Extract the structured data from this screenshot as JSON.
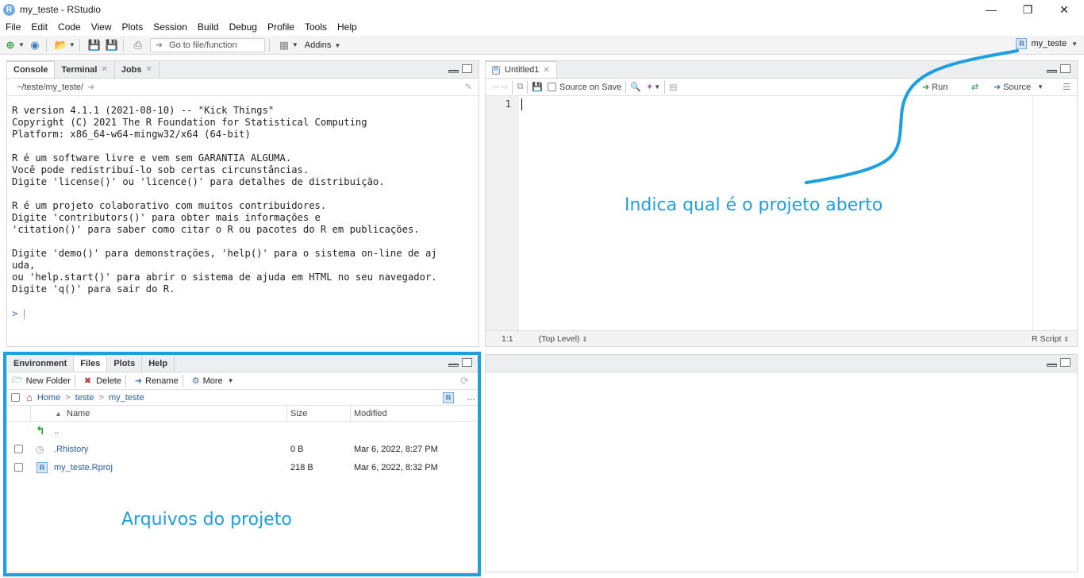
{
  "window": {
    "title": "my_teste - RStudio",
    "logo_letter": "R"
  },
  "menubar": [
    "File",
    "Edit",
    "Code",
    "View",
    "Plots",
    "Session",
    "Build",
    "Debug",
    "Profile",
    "Tools",
    "Help"
  ],
  "toolbar": {
    "goto_placeholder": "Go to file/function",
    "addins_label": "Addins",
    "project_name": "my_teste"
  },
  "console": {
    "tabs": [
      {
        "label": "Console",
        "active": true
      },
      {
        "label": "Terminal"
      },
      {
        "label": "Jobs"
      }
    ],
    "path": "~/teste/my_teste/",
    "lines": [
      "R version 4.1.1 (2021-08-10) -- \"Kick Things\"",
      "Copyright (C) 2021 The R Foundation for Statistical Computing",
      "Platform: x86_64-w64-mingw32/x64 (64-bit)",
      "",
      "R é um software livre e vem sem GARANTIA ALGUMA.",
      "Você pode redistribuí-lo sob certas circunstâncias.",
      "Digite 'license()' ou 'licence()' para detalhes de distribuição.",
      "",
      "R é um projeto colaborativo com muitos contribuidores.",
      "Digite 'contributors()' para obter mais informações e",
      "'citation()' para saber como citar o R ou pacotes do R em publicações.",
      "",
      "Digite 'demo()' para demonstrações, 'help()' para o sistema on-line de aj",
      "uda,",
      "ou 'help.start()' para abrir o sistema de ajuda em HTML no seu navegador.",
      "Digite 'q()' para sair do R."
    ],
    "prompt": ">"
  },
  "editor": {
    "tab_label": "Untitled1",
    "source_on_save": "Source on Save",
    "run_label": "Run",
    "source_label": "Source",
    "line_number": "1",
    "cursor_pos": "1:1",
    "scope": "(Top Level)",
    "file_type": "R Script"
  },
  "files_pane": {
    "tabs": [
      {
        "label": "Environment"
      },
      {
        "label": "Files",
        "active": true
      },
      {
        "label": "Plots"
      },
      {
        "label": "Help"
      }
    ],
    "toolbar": {
      "new_folder": "New Folder",
      "delete": "Delete",
      "rename": "Rename",
      "more": "More"
    },
    "breadcrumb": [
      "Home",
      "teste",
      "my_teste"
    ],
    "columns": {
      "name": "Name",
      "size": "Size",
      "modified": "Modified"
    },
    "up_label": "..",
    "rows": [
      {
        "name": ".Rhistory",
        "size": "0 B",
        "modified": "Mar 6, 2022, 8:27 PM"
      },
      {
        "name": "my_teste.Rproj",
        "size": "218 B",
        "modified": "Mar 6, 2022, 8:32 PM"
      }
    ]
  },
  "annotations": {
    "project_label": "Indica qual é o projeto aberto",
    "files_label": "Arquivos do projeto",
    "color": "#1d9fe0"
  }
}
